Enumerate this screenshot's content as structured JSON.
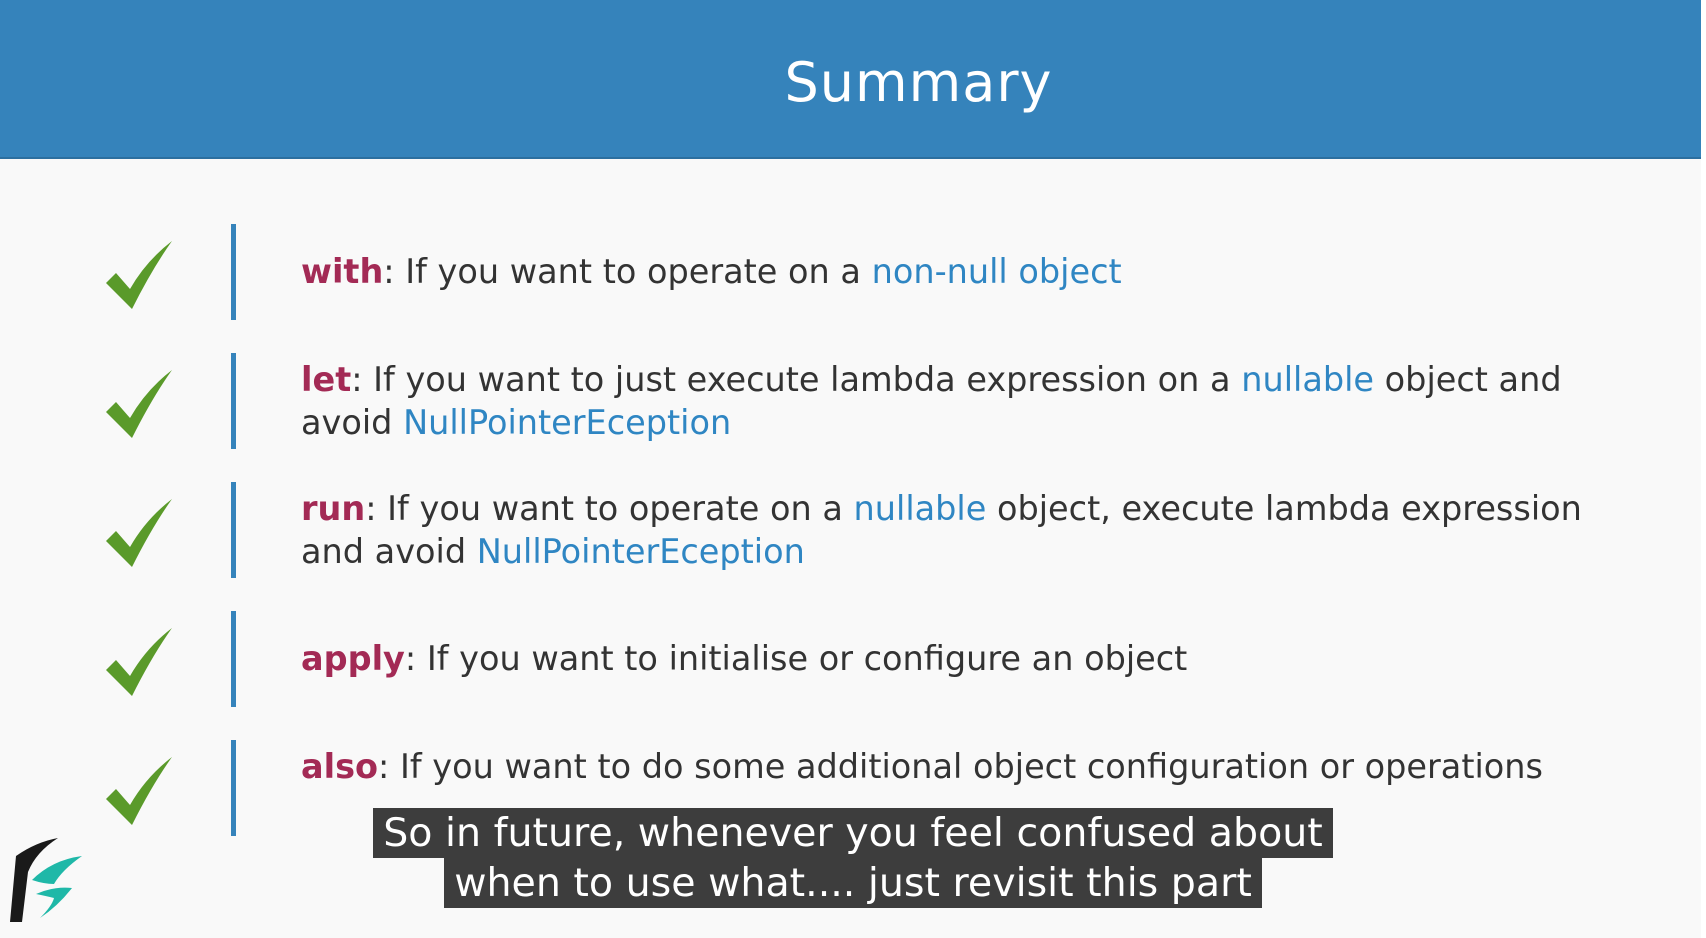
{
  "header": {
    "title": "Summary"
  },
  "colors": {
    "header_bg": "#3583bb",
    "keyword": "#a32a55",
    "highlight": "#2f86c3",
    "check": "#5a9a2a",
    "bar": "#3583bb"
  },
  "rows": [
    {
      "icon": "checkmark-icon",
      "keyword": "with",
      "t1": ": If you want to operate on a ",
      "h1": "non-null object"
    },
    {
      "icon": "checkmark-icon",
      "keyword": "let",
      "t1": ": If you want to just execute lambda expression on a ",
      "h1": "nullable",
      "t2": " object and avoid ",
      "h2": "NullPointerEception"
    },
    {
      "icon": "checkmark-icon",
      "keyword": "run",
      "t1": ": If you want to operate on a ",
      "h1": "nullable",
      "t2": " object, execute lambda expression and avoid ",
      "h2": "NullPointerEception"
    },
    {
      "icon": "checkmark-icon",
      "keyword": "apply",
      "t1": ": If you want to initialise or configure an object"
    },
    {
      "icon": "checkmark-icon",
      "keyword": "also",
      "t1": ": If you want to do some additional object configuration or operations"
    }
  ],
  "captions": {
    "line1": "So in future, whenever you feel confused about",
    "line2": "when to use what.... just revisit this part"
  },
  "logo": {
    "icon": "brand-logo-icon"
  }
}
